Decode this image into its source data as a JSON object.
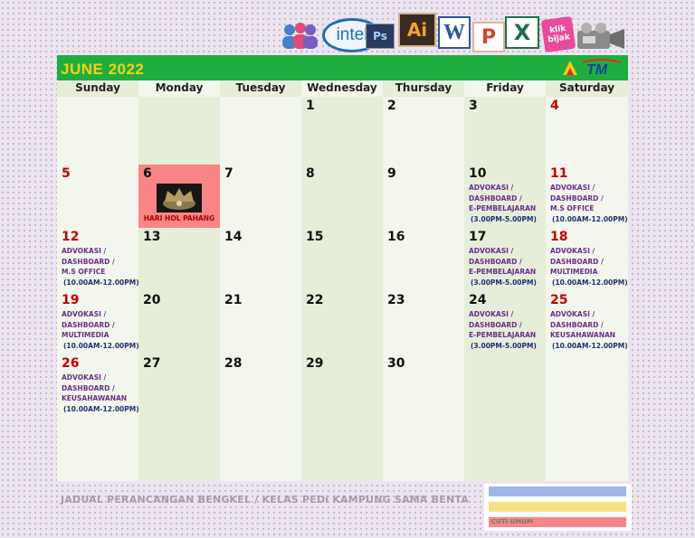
{
  "title": "JUNE 2022",
  "day_names": [
    "Sunday",
    "Monday",
    "Tuesday",
    "Wednesday",
    "Thursday",
    "Friday",
    "Saturday"
  ],
  "icons": {
    "intel_text": "intel",
    "ps_text": "Ps",
    "ai_text": "Ai",
    "word_text": "W",
    "ppt_text": "P",
    "excel_text": "X",
    "klik_text": "klik bijak"
  },
  "logo": {
    "text": "TM"
  },
  "cells": [
    {
      "date": ""
    },
    {
      "date": ""
    },
    {
      "date": ""
    },
    {
      "date": "1"
    },
    {
      "date": "2"
    },
    {
      "date": "3"
    },
    {
      "date": "4"
    },
    {
      "date": "5"
    },
    {
      "date": "6",
      "holiday": "HARI HOL PAHANG"
    },
    {
      "date": "7"
    },
    {
      "date": "8"
    },
    {
      "date": "9"
    },
    {
      "date": "10",
      "event": [
        "ADVOKASI /",
        "DASHBOARD /",
        "E-PEMBELAJARAN"
      ],
      "time": "(3.00PM-5.00PM)"
    },
    {
      "date": "11",
      "event": [
        "ADVOKASI /",
        "DASHBOARD /",
        "M.S OFFICE"
      ],
      "time": "(10.00AM-12.00PM)"
    },
    {
      "date": "12",
      "event": [
        "ADVOKASI /",
        "DASHBOARD /",
        "M.S OFFICE"
      ],
      "time": "(10.00AM-12.00PM)"
    },
    {
      "date": "13"
    },
    {
      "date": "14"
    },
    {
      "date": "15"
    },
    {
      "date": "16"
    },
    {
      "date": "17",
      "event": [
        "ADVOKASI /",
        "DASHBOARD /",
        "E-PEMBELAJARAN"
      ],
      "time": "(3.00PM-5.00PM)"
    },
    {
      "date": "18",
      "event": [
        "ADVOKASI /",
        "DASHBOARD /",
        "MULTIMEDIA"
      ],
      "time": "(10.00AM-12.00PM)"
    },
    {
      "date": "19",
      "event": [
        "ADVOKASI /",
        "DASHBOARD /",
        "MULTIMEDIA"
      ],
      "time": "(10.00AM-12.00PM)"
    },
    {
      "date": "20"
    },
    {
      "date": "21"
    },
    {
      "date": "22"
    },
    {
      "date": "23"
    },
    {
      "date": "24",
      "event": [
        "ADVOKASI /",
        "DASHBOARD /",
        "E-PEMBELAJARAN"
      ],
      "time": "(3.00PM-5.00PM)"
    },
    {
      "date": "25",
      "event": [
        "ADVOKASI /",
        "DASHBOARD /",
        "KEUSAHAWANAN"
      ],
      "time": "(10.00AM-12.00PM)"
    },
    {
      "date": "26",
      "event": [
        "ADVOKASI /",
        "DASHBOARD /",
        "KEUSAHAWANAN"
      ],
      "time": "(10.00AM-12.00PM)"
    },
    {
      "date": "27"
    },
    {
      "date": "28"
    },
    {
      "date": "29"
    },
    {
      "date": "30"
    },
    {
      "date": ""
    },
    {
      "date": ""
    },
    {
      "date": ""
    },
    {
      "date": ""
    },
    {
      "date": ""
    },
    {
      "date": ""
    },
    {
      "date": ""
    },
    {
      "date": ""
    },
    {
      "date": ""
    }
  ],
  "footer": "JADUAL PERANCANGAN BENGKEL / KELAS PEDi KAMPUNG SAMA BENTA",
  "legend": {
    "colors": [
      "#9db8e8",
      "#f9df84",
      "#f98686"
    ],
    "red_label": "CUTI UMUM"
  },
  "colors": {
    "header_green": "#1fae3e",
    "title_yellow": "#f7d117",
    "weekend_red": "#c00000",
    "holiday_bg": "#f98686",
    "event_purple": "#6a2e8e"
  }
}
